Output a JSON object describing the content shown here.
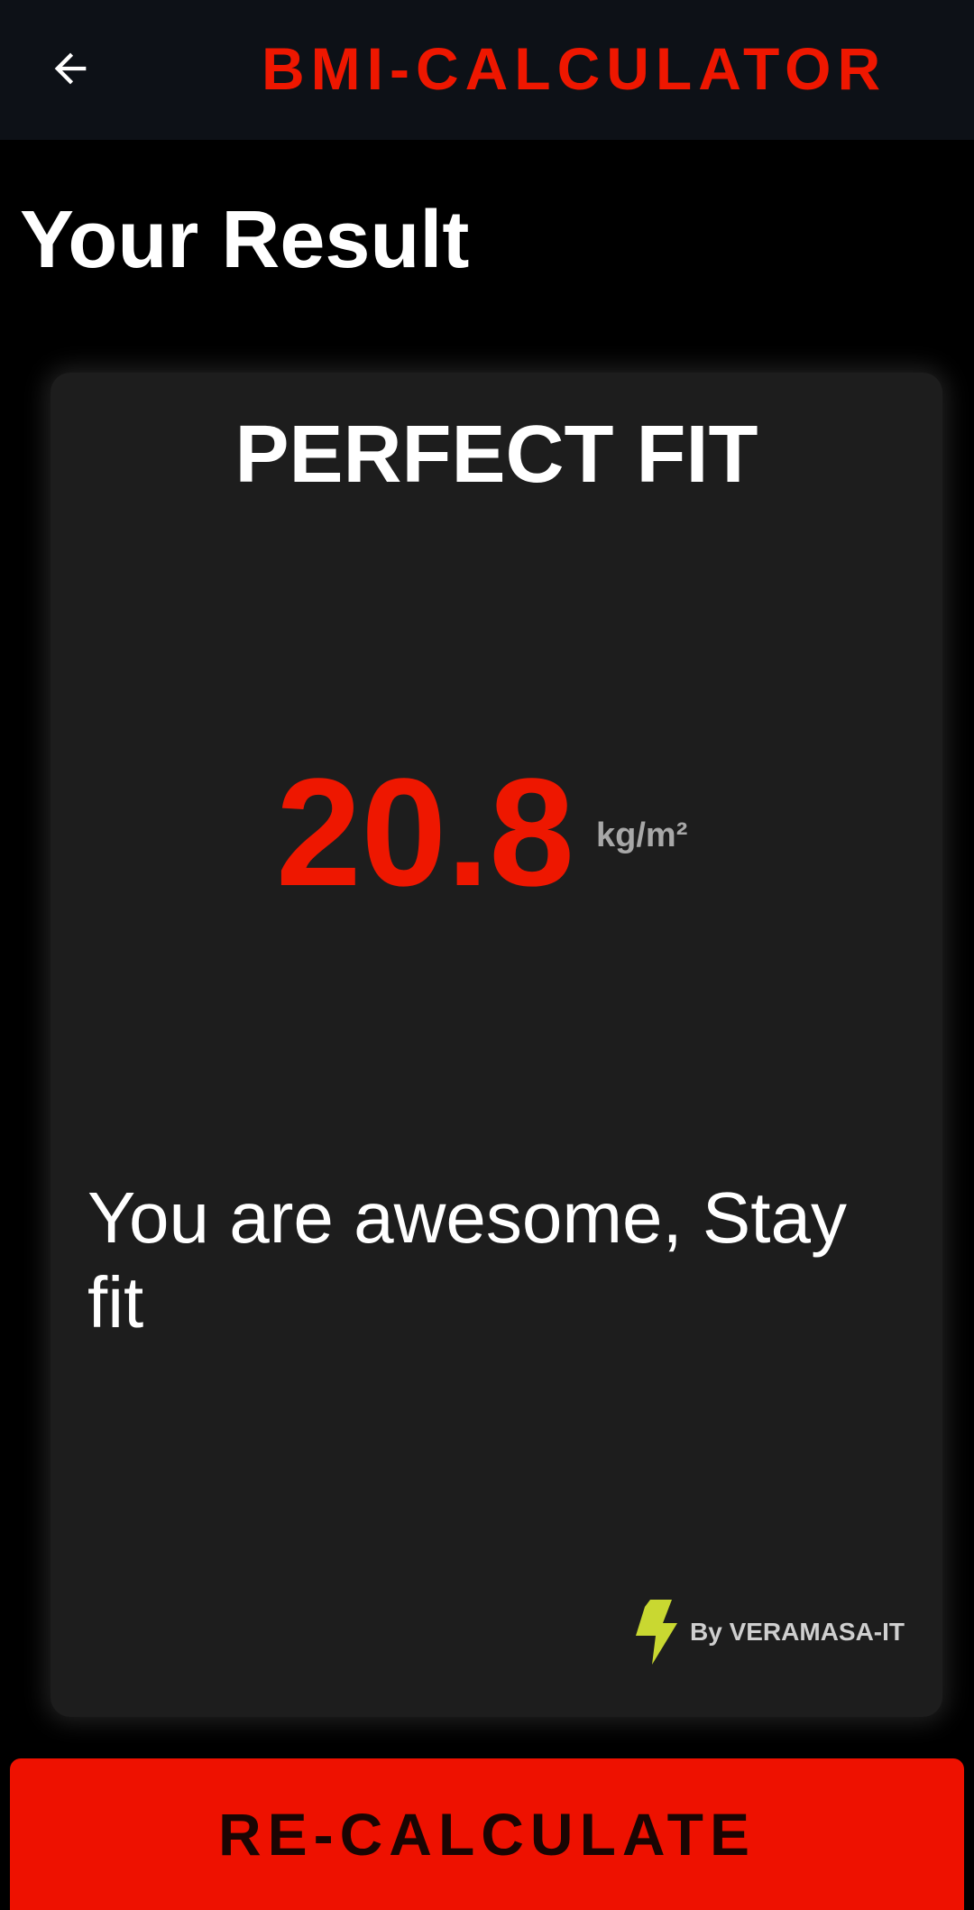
{
  "app_bar": {
    "back_icon": "arrow-left-icon",
    "title": "BMI-CALCULATOR"
  },
  "page": {
    "title": "Your Result"
  },
  "result": {
    "status": "PERFECT FIT",
    "bmi_value": "20.8",
    "bmi_unit": "kg/m²",
    "message": "You are awesome, Stay fit",
    "credit_icon": "lightning-bolt-icon",
    "credit": "By VERAMASA-IT"
  },
  "actions": {
    "recalculate_label": "RE-CALCULATE"
  },
  "colors": {
    "accent": "#ee1700",
    "app_bar_bg": "#0d1117",
    "card_bg": "#1d1d1d",
    "background": "#000000",
    "credit_icon": "#c9d831",
    "unit_text": "#a8a8a8"
  }
}
